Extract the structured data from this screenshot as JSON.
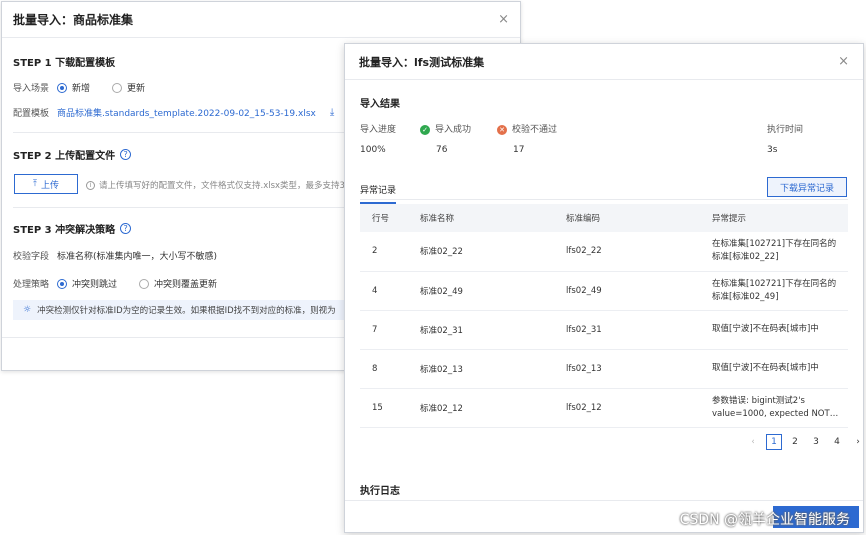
{
  "back_dialog": {
    "title": "批量导入：商品标准集",
    "close": "×",
    "step1": {
      "title": "STEP 1 下载配置模板"
    },
    "scene": {
      "label": "导入场景",
      "options": [
        "新增",
        "更新"
      ],
      "selected": 0
    },
    "template": {
      "label": "配置模板",
      "filename": "商品标准集.standards_template.2022-09-02_15-53-19.xlsx"
    },
    "step2": {
      "title": "STEP 2 上传配置文件"
    },
    "upload": {
      "label": "上传",
      "hint": "请上传填写好的配置文件，文件格式仅支持.xlsx类型，最多支持3"
    },
    "step3": {
      "title": "STEP 3 冲突解决策略"
    },
    "check_field": {
      "label": "校验字段",
      "value": "标准名称(标准集内唯一，大小写不敏感)"
    },
    "strategy": {
      "label": "处理策略",
      "options": [
        "冲突则跳过",
        "冲突则覆盖更新"
      ],
      "selected": 0
    },
    "tip": "冲突检测仅针对标准ID为空的记录生效。如果根据ID找不到对应的标准，则视为"
  },
  "front_dialog": {
    "title": "批量导入：lfs测试标准集",
    "close": "×",
    "result_title": "导入结果",
    "stats": {
      "progress_label": "导入进度",
      "progress_value": "100%",
      "success_label": "导入成功",
      "success_value": "76",
      "fail_label": "校验不通过",
      "fail_value": "17",
      "time_label": "执行时间",
      "time_value": "3s"
    },
    "tab": "异常记录",
    "download_btn": "下载异常记录",
    "table": {
      "headers": [
        "行号",
        "标准名称",
        "标准编码",
        "异常提示"
      ],
      "rows": [
        {
          "line": "2",
          "name": "标准02_22",
          "code": "lfs02_22",
          "msg": "在标准集[102721]下存在同名的标准[标准02_22]"
        },
        {
          "line": "4",
          "name": "标准02_49",
          "code": "lfs02_49",
          "msg": "在标准集[102721]下存在同名的标准[标准02_49]"
        },
        {
          "line": "7",
          "name": "标准02_31",
          "code": "lfs02_31",
          "msg": "取值[宁波]不在码表[城市]中"
        },
        {
          "line": "8",
          "name": "标准02_13",
          "code": "lfs02_13",
          "msg": "取值[宁波]不在码表[城市]中"
        },
        {
          "line": "15",
          "name": "标准02_12",
          "code": "lfs02_12",
          "msg": "参数错误: bigint测试2's value=1000, expected NOT greater ..."
        }
      ]
    },
    "pager": {
      "prev": "‹",
      "pages": [
        "1",
        "2",
        "3",
        "4"
      ],
      "current": 0,
      "next": "›"
    },
    "log_title": "执行日志"
  },
  "watermark": "CSDN @瓴羊企业智能服务",
  "colors": {
    "accent": "#2d6ad1",
    "success": "#2fa84f",
    "error": "#e3704a"
  }
}
